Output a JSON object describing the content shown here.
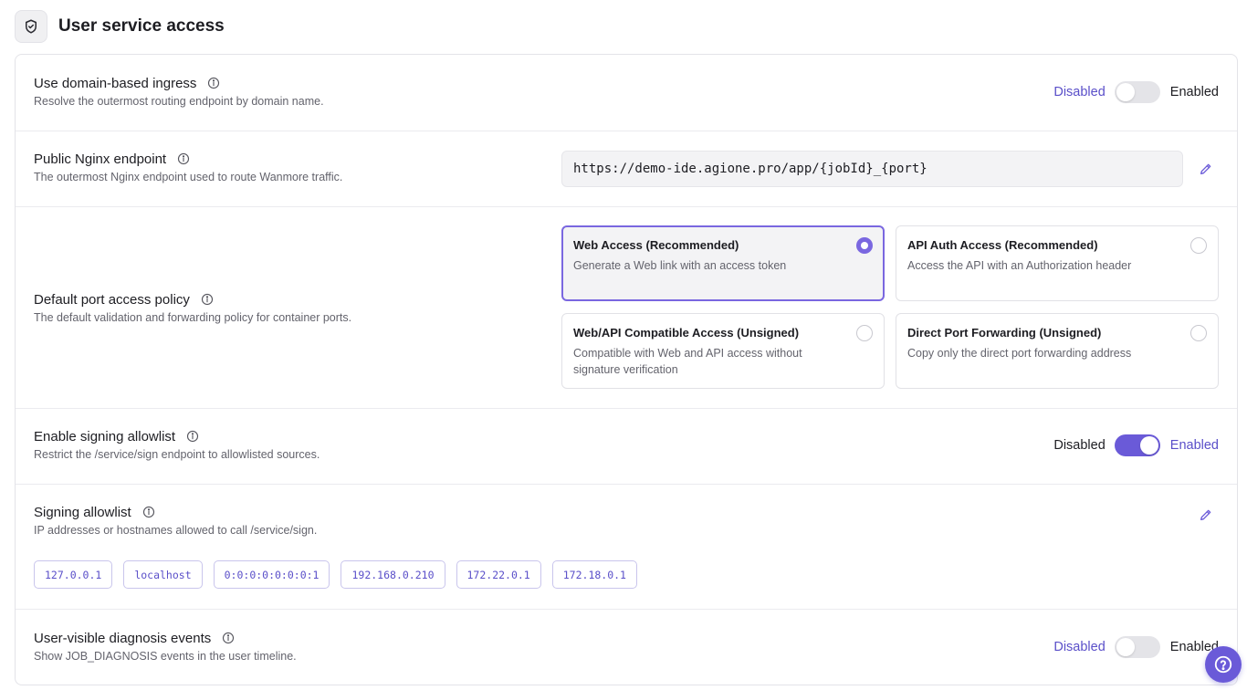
{
  "header": {
    "title": "User service access",
    "icon": "shield-check-icon"
  },
  "domain_ingress": {
    "title": "Use domain-based ingress",
    "desc": "Resolve the outermost routing endpoint by domain name.",
    "disabled_label": "Disabled",
    "enabled_label": "Enabled",
    "enabled": false
  },
  "nginx": {
    "title": "Public Nginx endpoint",
    "desc": "The outermost Nginx endpoint used to route Wanmore traffic.",
    "value": "https://demo-ide.agione.pro/app/{jobId}_{port}"
  },
  "port_policy": {
    "title": "Default port access policy",
    "desc": "The default validation and forwarding policy for container ports.",
    "options": [
      {
        "title": "Web Access (Recommended)",
        "desc": "Generate a Web link with an access token",
        "selected": true
      },
      {
        "title": "API Auth Access (Recommended)",
        "desc": "Access the API with an Authorization header",
        "selected": false
      },
      {
        "title": "Web/API Compatible Access (Unsigned)",
        "desc": "Compatible with Web and API access without signature verification",
        "selected": false
      },
      {
        "title": "Direct Port Forwarding (Unsigned)",
        "desc": "Copy only the direct port forwarding address",
        "selected": false
      }
    ]
  },
  "signing_allowlist_toggle": {
    "title": "Enable signing allowlist",
    "desc": "Restrict the /service/sign endpoint to allowlisted sources.",
    "disabled_label": "Disabled",
    "enabled_label": "Enabled",
    "enabled": true
  },
  "signing_allowlist": {
    "title": "Signing allowlist",
    "desc": "IP addresses or hostnames allowed to call /service/sign.",
    "entries": [
      "127.0.0.1",
      "localhost",
      "0:0:0:0:0:0:0:1",
      "192.168.0.210",
      "172.22.0.1",
      "172.18.0.1"
    ]
  },
  "diagnosis": {
    "title": "User-visible diagnosis events",
    "desc": "Show JOB_DIAGNOSIS events in the user timeline.",
    "disabled_label": "Disabled",
    "enabled_label": "Enabled",
    "enabled": false
  },
  "colors": {
    "accent": "#6a5ad8",
    "border": "#e3e3e8"
  }
}
